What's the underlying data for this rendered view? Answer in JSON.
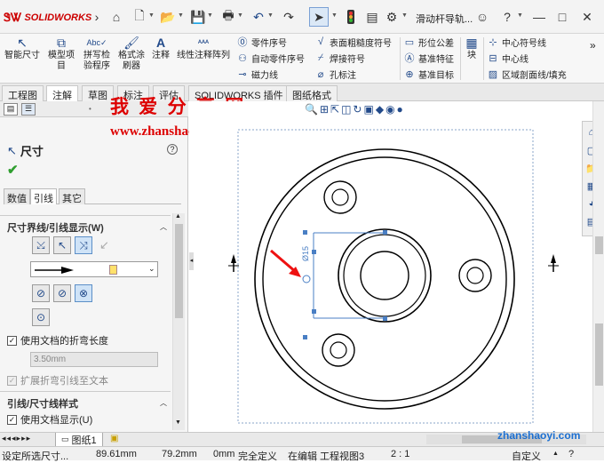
{
  "app": {
    "brand": "SOLIDWORKS",
    "window_title": "滑动杆导轨...",
    "accent": "#cc0000"
  },
  "ribbon": {
    "smart_dimension": "智能尺寸",
    "model_items": "模型项目",
    "spell_check": "拼写检验程序",
    "format_painter": "格式涂刷器",
    "note": "注释",
    "linear_note_pattern": "线性注释阵列",
    "balloon": "零件序号",
    "auto_balloon": "自动零件序号",
    "magnetic_line": "磁力线",
    "surface_finish": "表面粗糙度符号",
    "weld_symbol": "焊接符号",
    "hole_callout": "孔标注",
    "geometric_tolerance": "形位公差",
    "datum_feature": "基准特征",
    "datum_target": "基准目标",
    "block": "块",
    "center_mark": "中心符号线",
    "centerline": "中心线",
    "area_hatch": "区域剖面线/填充"
  },
  "tabs": [
    "工程图",
    "注解",
    "草图",
    "标注",
    "评估",
    "SOLIDWORKS 插件",
    "图纸格式"
  ],
  "active_tab": "注解",
  "watermark": {
    "title": "我 爱 分 享 网",
    "url": "www.zhanshaoyi.com",
    "corner_url": "zhanshaoyi.com"
  },
  "panel": {
    "title": "尺寸",
    "help": "?",
    "subtabs": [
      "数值",
      "引线",
      "其它"
    ],
    "active_subtab": "引线",
    "section1": "尺寸界线/引线显示(W)",
    "use_doc_bend": "使用文档的折弯长度",
    "bend_length": "3.50mm",
    "extend_bend": "扩展折弯引线至文本",
    "section2": "引线/尺寸线样式",
    "use_doc_display": "使用文档显示(U)"
  },
  "drawing": {
    "dim_text": "Ø15"
  },
  "sheet": {
    "name": "图纸1"
  },
  "status": {
    "hint": "设定所选尺寸...",
    "x": "89.61mm",
    "y": "79.2mm",
    "z": "0mm",
    "def": "完全定义",
    "editing": "在编辑 工程视图3",
    "scale": "2 : 1",
    "custom": "自定义"
  }
}
